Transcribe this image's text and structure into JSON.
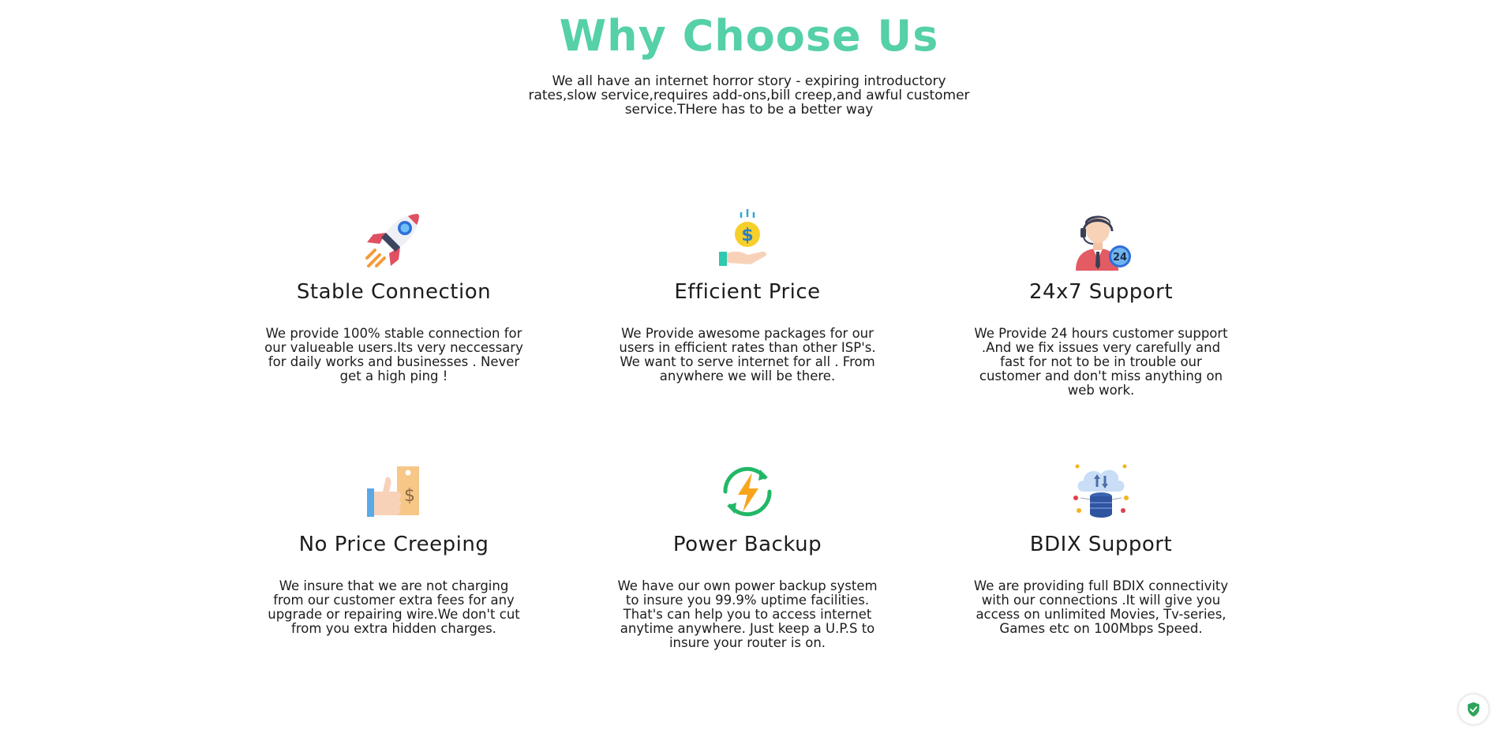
{
  "section": {
    "title": "Why Choose Us",
    "intro": "We all have an internet horror story - expiring introductory rates,slow service,requires add-ons,bill creep,and awful customer service.THere has to be a better way"
  },
  "colors": {
    "accent": "#55d0a8",
    "text": "#1c1c1c"
  },
  "features": [
    {
      "icon": "rocket-icon",
      "title": "Stable Connection",
      "description": "We provide 100% stable connection for our valueable users.Its very neccessary for daily works and businesses . Never get a high ping !"
    },
    {
      "icon": "money-hand-icon",
      "title": "Efficient Price",
      "description": "We Provide awesome packages for our users in efficient rates than other ISP's. We want to serve internet for all . From anywhere we will be there."
    },
    {
      "icon": "support-agent-icon",
      "title": "24x7 Support",
      "description": "We Provide 24 hours customer support .And we fix issues very carefully and fast for not to be in trouble our customer and don't miss anything on web work."
    },
    {
      "icon": "thumbs-up-price-tag-icon",
      "title": "No Price Creeping",
      "description": "We insure that we are not charging from our customer extra fees for any upgrade or repairing wire.We don't cut from you extra hidden charges."
    },
    {
      "icon": "power-refresh-icon",
      "title": "Power Backup",
      "description": "We have our own power backup system to insure you 99.9% uptime facilities. That's can help you to access internet anytime anywhere. Just keep a U.P.S to insure your router is on."
    },
    {
      "icon": "cloud-database-icon",
      "title": "BDIX Support",
      "description": "We are providing full BDIX connectivity with our connections .It will give you access on unlimited Movies, Tv-series, Games etc on 100Mbps Speed."
    }
  ],
  "badge": {
    "icon": "shield-check-icon"
  }
}
